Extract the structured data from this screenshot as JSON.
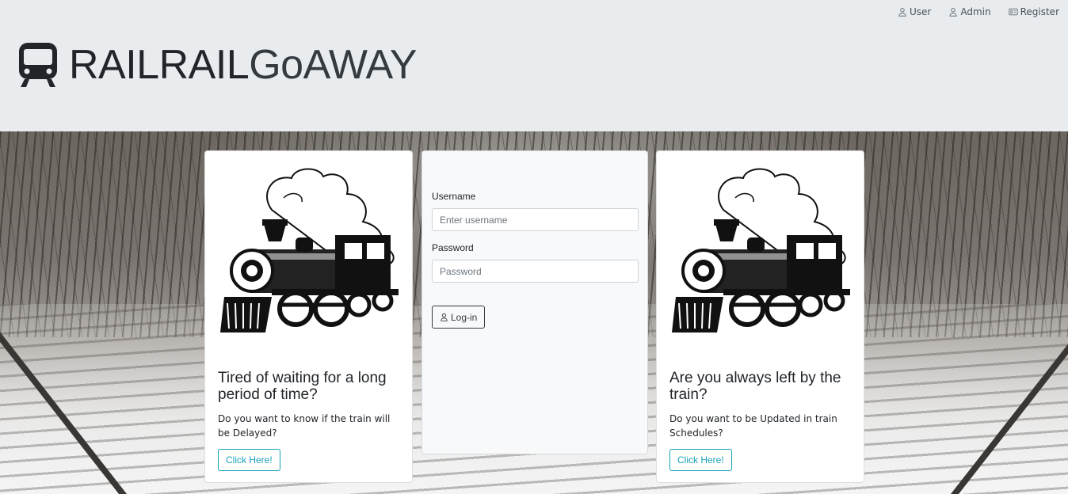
{
  "nav": {
    "user_label": "User",
    "admin_label": "Admin",
    "register_label": "Register"
  },
  "brand": {
    "part1": "RAILRAIL",
    "part2": "GoAWAY"
  },
  "cards": {
    "left": {
      "title": "Tired of waiting for a long period of time?",
      "text": "Do you want to know if the train will be Delayed?",
      "button": "Click Here!"
    },
    "right": {
      "title": "Are you always left by the train?",
      "text": "Do you want to be Updated in train Schedules?",
      "button": "Click Here!"
    }
  },
  "login": {
    "username_label": "Username",
    "username_placeholder": "Enter username",
    "password_label": "Password",
    "password_placeholder": "Password",
    "button": "Log-in"
  },
  "colors": {
    "header_bg": "#e9ecef",
    "info": "#17a2b8",
    "dark": "#343a40"
  }
}
